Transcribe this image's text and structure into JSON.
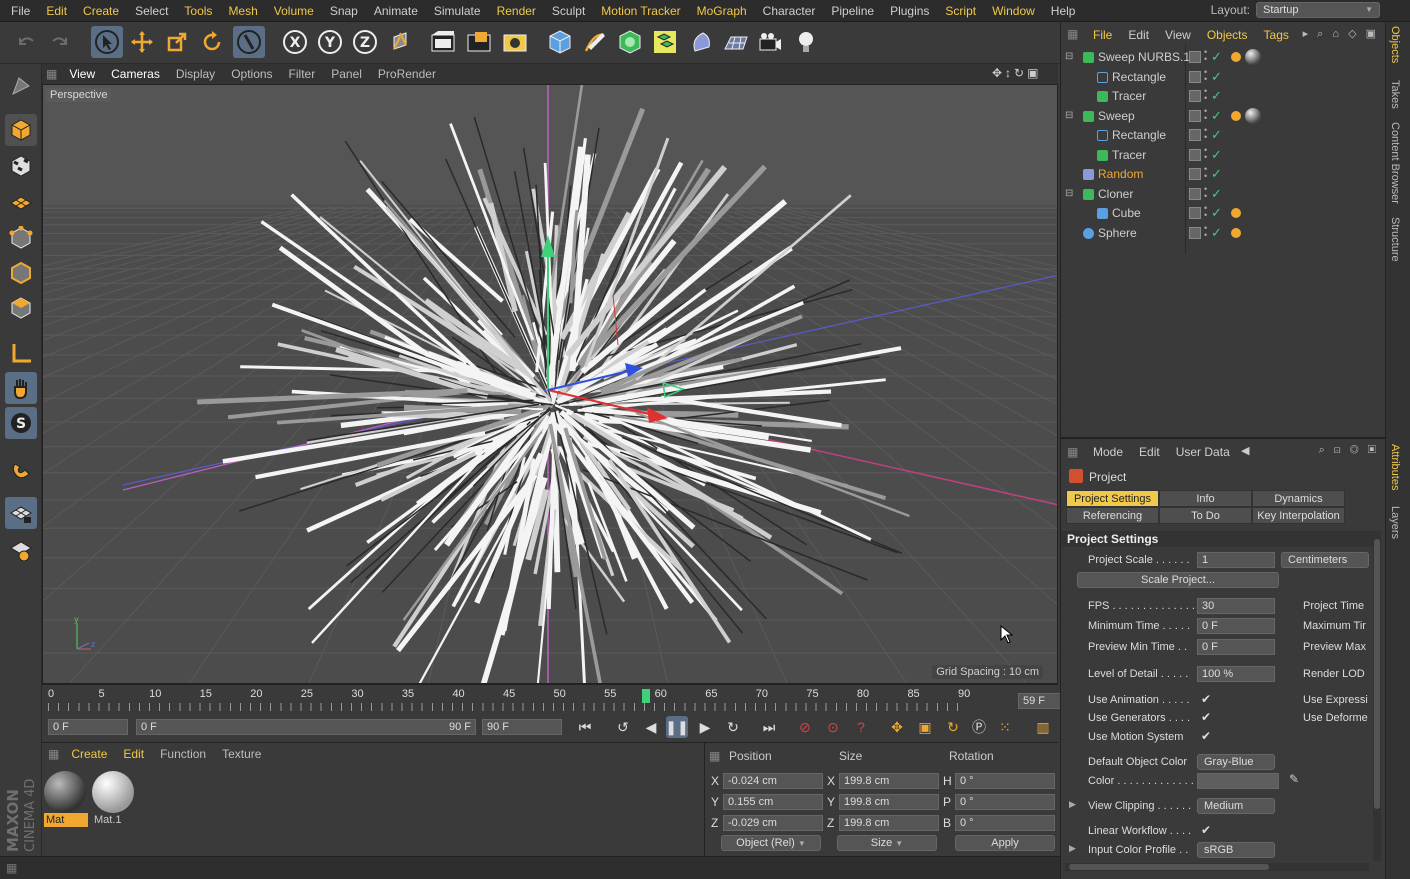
{
  "menubar": {
    "items": [
      "File",
      "Edit",
      "Create",
      "Select",
      "Tools",
      "Mesh",
      "Volume",
      "Snap",
      "Animate",
      "Simulate",
      "Render",
      "Sculpt",
      "Motion Tracker",
      "MoGraph",
      "Character",
      "Pipeline",
      "Plugins",
      "Script",
      "Window",
      "Help"
    ],
    "highlighted": [
      "Edit",
      "Create",
      "Tools",
      "Mesh",
      "Volume",
      "Render",
      "Motion Tracker",
      "MoGraph",
      "Script",
      "Window"
    ],
    "layout_label": "Layout:",
    "layout_value": "Startup"
  },
  "viewport": {
    "menu": [
      "View",
      "Cameras",
      "Display",
      "Options",
      "Filter",
      "Panel",
      "ProRender"
    ],
    "label": "Perspective",
    "grid_spacing": "Grid Spacing : 10 cm"
  },
  "timeline": {
    "ticks": [
      "0",
      "5",
      "10",
      "15",
      "20",
      "25",
      "30",
      "35",
      "40",
      "45",
      "50",
      "55",
      "60",
      "65",
      "70",
      "75",
      "80",
      "85",
      "90"
    ],
    "playhead_frame": 59,
    "current_frame": "59 F"
  },
  "transport": {
    "start": "0 F",
    "range_start": "0 F",
    "range_end": "90 F",
    "end": "90 F"
  },
  "materials": {
    "menu": [
      "Create",
      "Edit",
      "Function",
      "Texture"
    ],
    "items": [
      {
        "label": "Mat",
        "selected": true
      },
      {
        "label": "Mat.1",
        "selected": false
      }
    ]
  },
  "coordinates": {
    "headers": [
      "Position",
      "Size",
      "Rotation"
    ],
    "rows": [
      {
        "axis": "X",
        "pos": "-0.024 cm",
        "size_axis": "X",
        "size": "199.8 cm",
        "rot_axis": "H",
        "rot": "0 °"
      },
      {
        "axis": "Y",
        "pos": "0.155 cm",
        "size_axis": "Y",
        "size": "199.8 cm",
        "rot_axis": "P",
        "rot": "0 °"
      },
      {
        "axis": "Z",
        "pos": "-0.029 cm",
        "size_axis": "Z",
        "size": "199.8 cm",
        "rot_axis": "B",
        "rot": "0 °"
      }
    ],
    "mode": "Object (Rel)",
    "size_mode": "Size",
    "apply": "Apply"
  },
  "objects": {
    "menu": [
      "File",
      "Edit",
      "View",
      "Objects",
      "Tags"
    ],
    "rows": [
      {
        "name": "Sweep NURBS.1",
        "icon": "sweep-icon",
        "orange": false
      },
      {
        "name": "Rectangle",
        "icon": "rectangle-icon",
        "orange": false
      },
      {
        "name": "Tracer",
        "icon": "tracer-icon",
        "orange": false
      },
      {
        "name": "Sweep",
        "icon": "sweep-icon",
        "orange": false
      },
      {
        "name": "Rectangle",
        "icon": "rectangle-icon",
        "orange": false
      },
      {
        "name": "Tracer",
        "icon": "tracer-icon",
        "orange": false
      },
      {
        "name": "Random",
        "icon": "random-effector-icon",
        "orange": true
      },
      {
        "name": "Cloner",
        "icon": "cloner-icon",
        "orange": false
      },
      {
        "name": "Cube",
        "icon": "cube-icon",
        "orange": false
      },
      {
        "name": "Sphere",
        "icon": "sphere-icon",
        "orange": false
      }
    ]
  },
  "attributes": {
    "menu": [
      "Mode",
      "Edit",
      "User Data"
    ],
    "title": "Project",
    "tabs": [
      "Project Settings",
      "Info",
      "Dynamics",
      "Referencing",
      "To Do",
      "Key Interpolation"
    ],
    "section": "Project Settings",
    "project_scale_label": "Project Scale . . . . . .",
    "project_scale": "1",
    "project_scale_unit": "Centimeters",
    "scale_project_btn": "Scale Project...",
    "fps_label": "FPS . . . . . . . . . . . . . .",
    "fps": "30",
    "min_time_label": "Minimum Time . . . . .",
    "min_time": "0 F",
    "preview_min_label": "Preview Min Time . .",
    "preview_min": "0 F",
    "project_time_label": "Project Time",
    "max_time_label": "Maximum Tir",
    "preview_max_label": "Preview Max",
    "lod_label": "Level of Detail . . . . .",
    "lod": "100 %",
    "render_lod_label": "Render LOD",
    "use_animation": "Use Animation . . . . .",
    "use_generators": "Use Generators . . . .",
    "use_motion": "Use Motion System",
    "use_expressi": "Use Expressi",
    "use_deforme": "Use Deforme",
    "default_color_label": "Default Object Color",
    "default_color": "Gray-Blue",
    "color_label": "Color . . . . . . . . . . . . .",
    "view_clipping_label": "View Clipping . . . . . .",
    "view_clipping": "Medium",
    "linear_workflow": "Linear Workflow . . . .",
    "input_profile_label": "Input Color Profile . .",
    "input_profile": "sRGB"
  },
  "sidetabs": [
    "Objects",
    "Takes",
    "Content Browser",
    "Structure",
    "Attributes",
    "Layers"
  ],
  "branding": "MAXON CINEMA 4D"
}
